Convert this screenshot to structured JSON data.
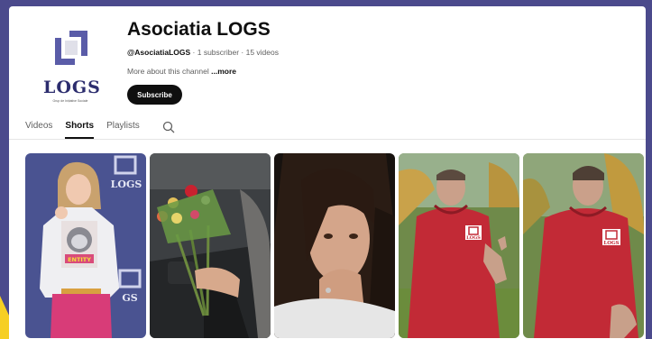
{
  "channel": {
    "name": "Asociatia LOGS",
    "handle": "@AsociatiaLOGS",
    "stats": "· 1 subscriber · 15 videos",
    "about_prefix": "More about this channel",
    "about_more": "...more",
    "subscribe_label": "Subscribe",
    "logo_text": "LOGS",
    "logo_tagline": "Grup de Inițiative Sociale"
  },
  "tabs": [
    {
      "label": "Videos"
    },
    {
      "label": "Shorts"
    },
    {
      "label": "Playlists"
    }
  ],
  "active_tab": "Shorts",
  "shorts": [
    {
      "thumb_badge": "LOGS",
      "shirt_text": "ENTITY"
    },
    {},
    {},
    {
      "thumb_badge": "LOGS"
    },
    {
      "thumb_badge": "LOGS"
    }
  ],
  "colors": {
    "outer_background": "#4b4a8c",
    "accent_yellow": "#f6cf23",
    "hoodie_red": "#c22a36",
    "logo_navy": "#2c2d6e"
  }
}
